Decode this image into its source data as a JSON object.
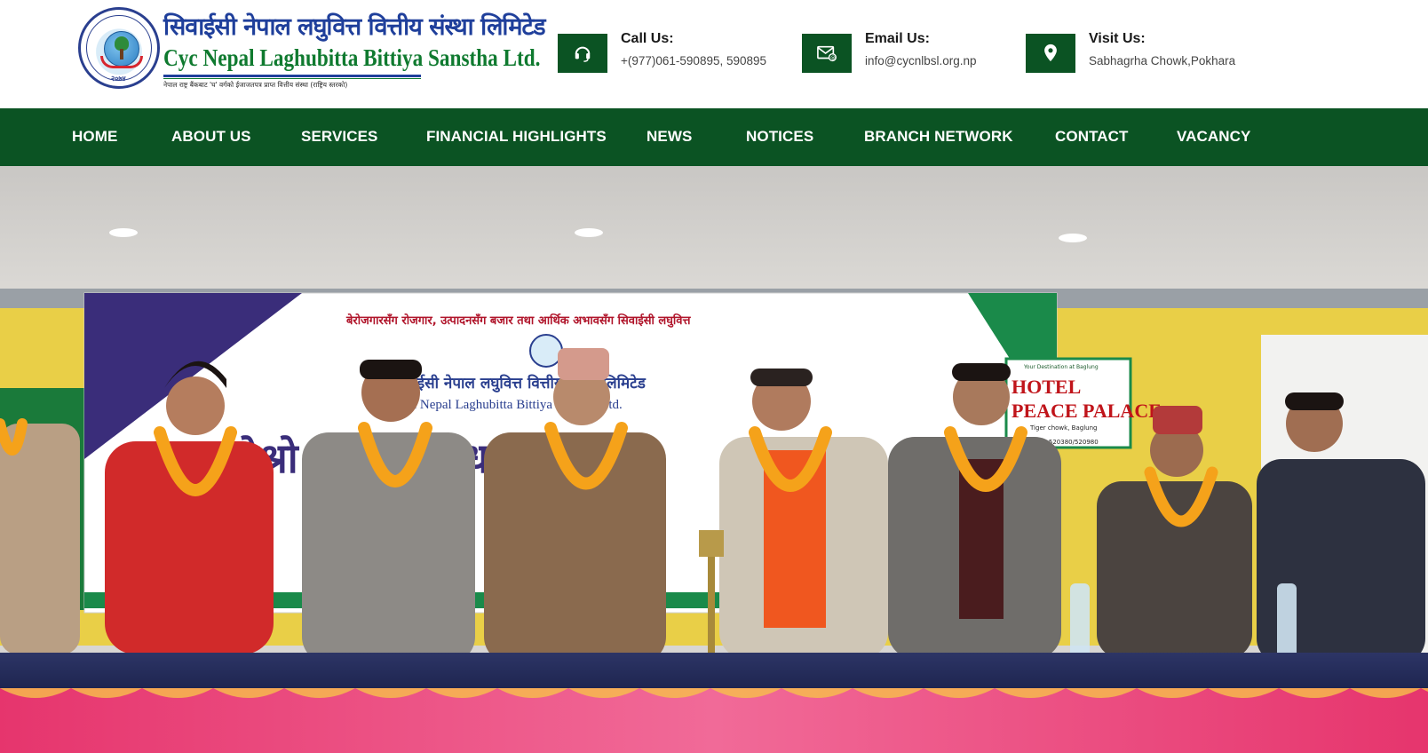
{
  "header": {
    "logo": {
      "name_nepali": "सिवाईसी नेपाल लघुवित्त वित्तीय संस्था लिमिटेड",
      "name_english": "Cyc Nepal Laghubitta Bittiya Sanstha Ltd.",
      "tagline": "नेपाल राष्ट्र बैंकबाट 'घ' वर्गको ईजाजतपत्र प्राप्त वित्तीय संस्था (राष्ट्रिय स्तरको)",
      "emblem_year": "२०७४"
    },
    "contacts": [
      {
        "icon": "headset-icon",
        "title": "Call Us:",
        "value": "+(977)061-590895, 590895"
      },
      {
        "icon": "envelope-icon",
        "title": "Email Us:",
        "value": "info@cycnlbsl.org.np"
      },
      {
        "icon": "location-pin-icon",
        "title": "Visit Us:",
        "value": "Sabhagrha Chowk,Pokhara"
      }
    ]
  },
  "nav": {
    "items": [
      "HOME",
      "ABOUT US",
      "SERVICES",
      "FINANCIAL HIGHLIGHTS",
      "NEWS",
      "NOTICES",
      "BRANCH NETWORK",
      "CONTACT",
      "VACANCY"
    ]
  },
  "hero": {
    "banner_slogan": "बेरोजगारसँग रोजगार, उत्पादनसँग बजार तथा आर्थिक अभावसँग सिवाईसी लघुवित्त",
    "banner_org_nepali": "सिवाईसी नेपाल लघुवित्त वित्तीय संस्था लिमिटेड",
    "banner_org_english": "Cyc Nepal Laghubitta Bittiya Sanstha Ltd.",
    "banner_heading": "तेश्रो वार्षिक साधारण सभा",
    "hotel_sign": {
      "top": "Your Destination at Baglung",
      "name_1": "HOTEL",
      "name_2": "PEACE PALACE",
      "location": "Tiger chowk, Baglung",
      "phone": "068-520380/520980"
    }
  },
  "colors": {
    "brand_green": "#0b5323",
    "brand_blue": "#1f3f9b",
    "text_dark": "#1a1a1a"
  }
}
